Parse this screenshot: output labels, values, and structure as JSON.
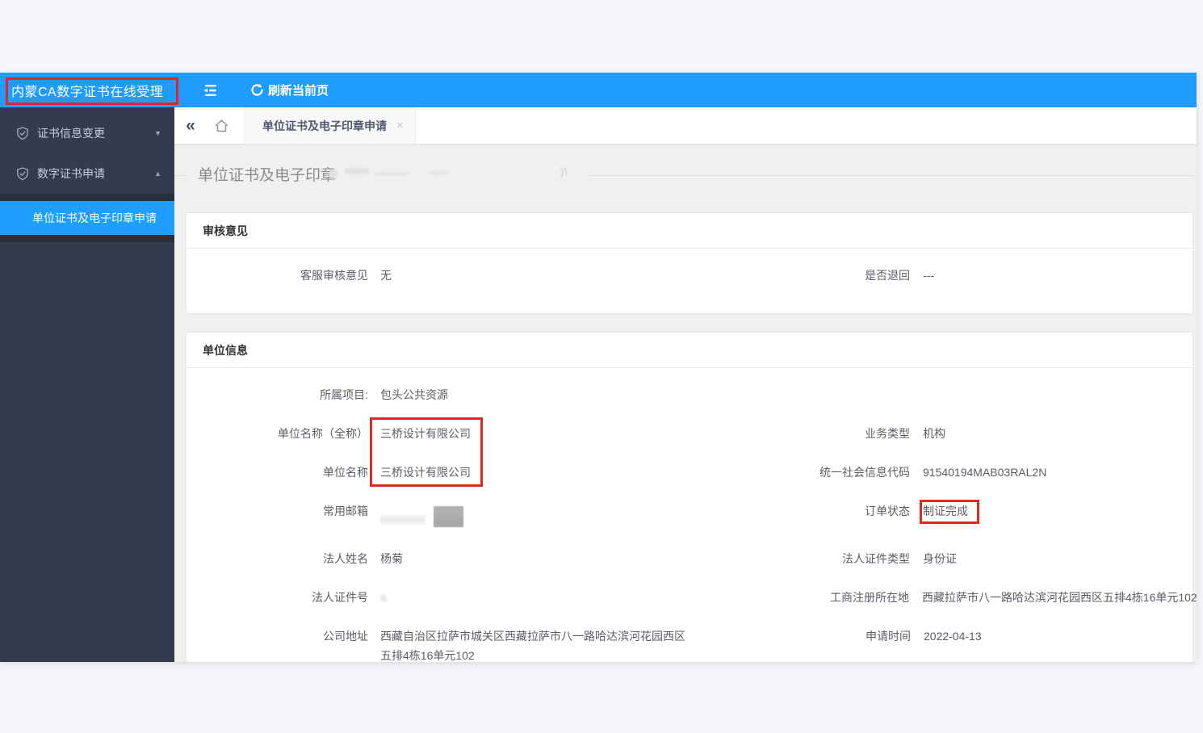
{
  "colors": {
    "header_blue": "#1f9cff",
    "active_item_blue": "#1e9fff",
    "sidebar_dark": "#333c4d",
    "submenu_dark": "#272e3c",
    "annotation_red": "#e0291e",
    "content_bg": "#f0f0f1",
    "page_bg": "#f5f6fa"
  },
  "sidebar": {
    "logo_title": "内蒙CA数字证书在线受理",
    "items": [
      {
        "label": "证书信息变更",
        "icon": "shield-check-icon",
        "caret_glyph": "▼"
      },
      {
        "label": "数字证书申请",
        "icon": "shield-check-icon",
        "caret_glyph": "▲"
      }
    ],
    "submenu_item": {
      "label": "单位证书及电子印章申请"
    }
  },
  "topbar": {
    "collapse_icon": "menu-fold-icon",
    "refresh_icon": "refresh-icon",
    "refresh_label": "刷新当前页"
  },
  "tabbar": {
    "back_glyph": "«",
    "home_icon": "home-icon",
    "active_tab": "单位证书及电子印章申请",
    "close_glyph": "×"
  },
  "main": {
    "page_title": "单位证书及电子印章"
  },
  "review": {
    "section_title": "审核意见",
    "service_opinion_label": "客服审核意见",
    "service_opinion_value": "无",
    "returned_label": "是否退回",
    "returned_value": "---"
  },
  "unit": {
    "section_title": "单位信息",
    "project_label": "所属项目:",
    "project_value": "包头公共资源",
    "name_full_label": "单位名称（全称）",
    "name_full_value": "三桥设计有限公司",
    "name_label": "单位名称",
    "name_value": "三桥设计有限公司",
    "email_label": "常用邮箱",
    "legal_name_label": "法人姓名",
    "legal_name_value": "杨菊",
    "legal_id_label": "法人证件号",
    "address_label": "公司地址",
    "address_value": "西藏自治区拉萨市城关区西藏拉萨市八一路哈达滨河花园西区五排4栋16单元102",
    "biz_type_label": "业务类型",
    "biz_type_value": "机构",
    "credit_code_label": "统一社会信息代码",
    "credit_code_value": "91540194MAB03RAL2N",
    "order_status_label": "订单状态",
    "order_status_value": "制证完成",
    "legal_id_type_label": "法人证件类型",
    "legal_id_type_value": "身份证",
    "reg_place_label": "工商注册所在地",
    "reg_place_value": "西藏拉萨市八一路哈达滨河花园西区五排4栋16单元102",
    "apply_time_label": "申请时间",
    "apply_time_value": "2022-04-13"
  }
}
